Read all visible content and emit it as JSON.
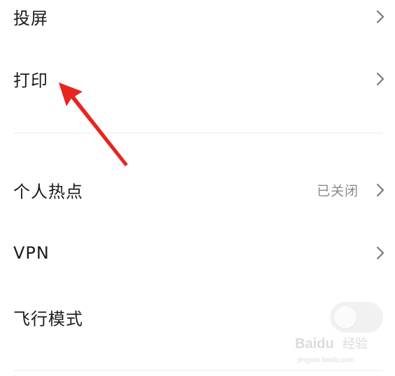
{
  "settings": {
    "rows": [
      {
        "label": "投屏"
      },
      {
        "label": "打印"
      },
      {
        "label": "个人热点",
        "value": "已关闭"
      },
      {
        "label": "VPN"
      },
      {
        "label": "飞行模式",
        "toggle_on": false
      }
    ]
  },
  "colors": {
    "text": "#1b1b1b",
    "secondary_text": "#8a8a8a",
    "chevron": "#7a7a7a",
    "divider": "#ececec",
    "toggle_off": "#f1f1f1",
    "annotation_arrow": "#e8251f"
  },
  "icons": {
    "chevron": "chevron-right-icon",
    "arrow": "red-annotation-arrow-icon",
    "watermark": "baidu-jingyan-watermark"
  },
  "watermark": {
    "brand": "Baidu",
    "text": "经验",
    "url": "jingyan.baidu.com"
  }
}
